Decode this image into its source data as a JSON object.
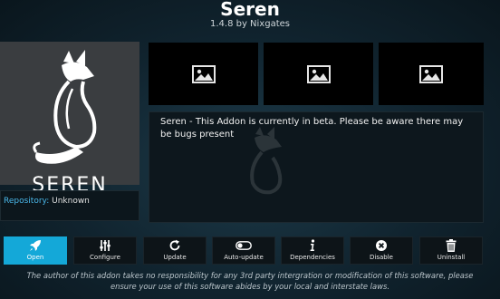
{
  "header": {
    "title": "Seren",
    "subtitle": "1.4.8 by Nixgates"
  },
  "logo": {
    "text": "SEREN"
  },
  "repository": {
    "label": "Repository:",
    "value": "Unknown"
  },
  "screenshots": [
    {
      "icon": "image-placeholder-icon"
    },
    {
      "icon": "image-placeholder-icon"
    },
    {
      "icon": "image-placeholder-icon"
    }
  ],
  "description": {
    "text": "Seren - This Addon is currently in beta. Please be aware there may be bugs present"
  },
  "actions": [
    {
      "label": "Open",
      "icon": "rocket-icon"
    },
    {
      "label": "Configure",
      "icon": "sliders-icon"
    },
    {
      "label": "Update",
      "icon": "refresh-icon"
    },
    {
      "label": "Auto-update",
      "icon": "toggle-icon"
    },
    {
      "label": "Dependencies",
      "icon": "info-icon"
    },
    {
      "label": "Disable",
      "icon": "disable-icon"
    },
    {
      "label": "Uninstall",
      "icon": "trash-icon"
    }
  ],
  "footer": {
    "line1": "The author of this addon takes no responsibility for any 3rd party intergration or modification of this software, please",
    "line2": "ensure your use of this software abides by your local and interstate laws."
  },
  "colors": {
    "accent": "#14a8d8",
    "logo_bg": "#3a3d40",
    "background": "#10232e"
  }
}
